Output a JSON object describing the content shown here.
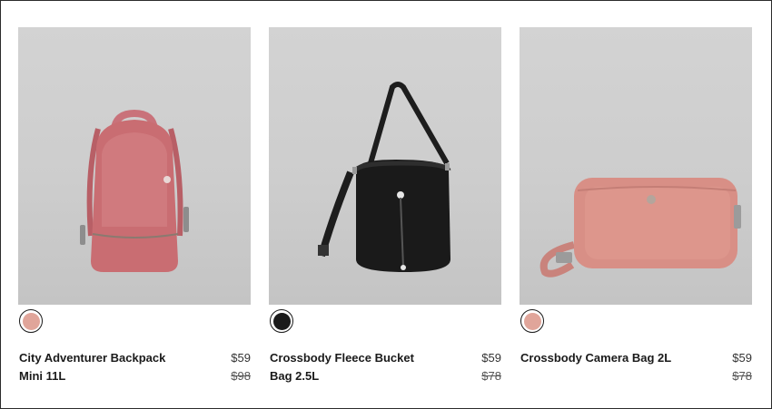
{
  "products": [
    {
      "name": "City Adventurer Backpack Mini 11L",
      "price": "$59",
      "original_price": "$98",
      "swatch_color": "#e0a59a",
      "image_icon": "pink-backpack-image"
    },
    {
      "name": "Crossbody Fleece Bucket Bag 2.5L",
      "price": "$59",
      "original_price": "$78",
      "swatch_color": "#1a1a1a",
      "image_icon": "black-fleece-bucket-bag-image"
    },
    {
      "name": "Crossbody Camera Bag 2L",
      "price": "$59",
      "original_price": "$78",
      "swatch_color": "#e0a59a",
      "image_icon": "pink-camera-bag-image"
    }
  ]
}
